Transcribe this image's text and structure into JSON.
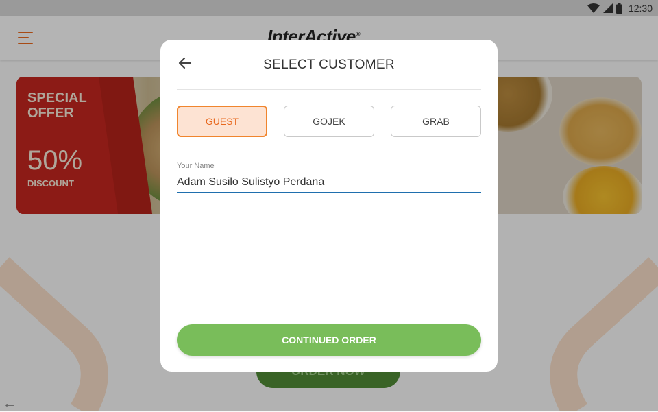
{
  "status_bar": {
    "time": "12:30",
    "icons": [
      "wifi-icon",
      "signal-icon",
      "battery-icon"
    ]
  },
  "app_bar": {
    "logo_text": "InterActive",
    "logo_mark": "®",
    "menu_icon": "hamburger-menu-icon"
  },
  "banner_left": {
    "offer_title": "SPECIAL OFFER",
    "discount_value": "50%",
    "discount_label": "DISCOUNT"
  },
  "background": {
    "order_now_label": "ORDER NOW"
  },
  "modal": {
    "title": "SELECT CUSTOMER",
    "back_icon": "arrow-left-icon",
    "customer_types": [
      {
        "label": "GUEST",
        "selected": true
      },
      {
        "label": "GOJEK",
        "selected": false
      },
      {
        "label": "GRAB",
        "selected": false
      }
    ],
    "name_field": {
      "label": "Your Name",
      "value": "Adam Susilo Sulistyo Perdana"
    },
    "continue_label": "CONTINUED ORDER"
  },
  "colors": {
    "accent_orange": "#e8681e",
    "primary_green": "#79bd5a",
    "input_underline": "#1f6fae",
    "offer_red": "#c3261f"
  }
}
